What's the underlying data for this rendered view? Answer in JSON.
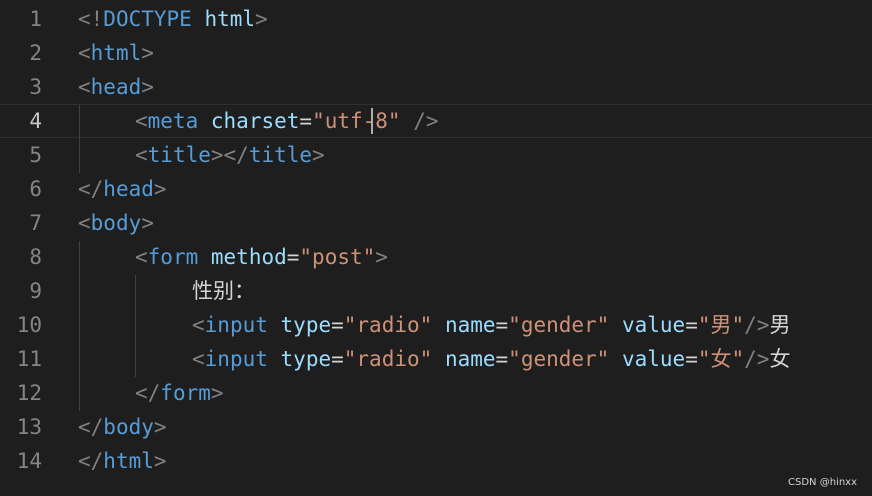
{
  "editor": {
    "language": "html",
    "active_line": 4,
    "cursor": {
      "line": 4,
      "column": 21
    },
    "colors": {
      "background": "#1e1e1e",
      "line_number": "#858585",
      "line_number_active": "#c6c6c6",
      "punctuation": "#808080",
      "tag": "#569cd6",
      "attribute": "#9cdcfe",
      "string": "#ce9178",
      "text": "#d4d4d4"
    },
    "lines": [
      {
        "number": "1",
        "indent": 0,
        "tokens": [
          [
            "p",
            "<!"
          ],
          [
            "k",
            "DOCTYPE"
          ],
          [
            "o",
            " "
          ],
          [
            "a",
            "html"
          ],
          [
            "p",
            ">"
          ]
        ]
      },
      {
        "number": "2",
        "indent": 0,
        "tokens": [
          [
            "p",
            "<"
          ],
          [
            "k",
            "html"
          ],
          [
            "p",
            ">"
          ]
        ]
      },
      {
        "number": "3",
        "indent": 0,
        "tokens": [
          [
            "p",
            "<"
          ],
          [
            "k",
            "head"
          ],
          [
            "p",
            ">"
          ]
        ]
      },
      {
        "number": "4",
        "indent": 1,
        "tokens": [
          [
            "p",
            "<"
          ],
          [
            "k",
            "meta"
          ],
          [
            "o",
            " "
          ],
          [
            "a",
            "charset"
          ],
          [
            "o",
            "="
          ],
          [
            "s",
            "\"utf-8\""
          ],
          [
            "o",
            " "
          ],
          [
            "p",
            "/>"
          ]
        ]
      },
      {
        "number": "5",
        "indent": 1,
        "tokens": [
          [
            "p",
            "<"
          ],
          [
            "k",
            "title"
          ],
          [
            "p",
            "></"
          ],
          [
            "k",
            "title"
          ],
          [
            "p",
            ">"
          ]
        ]
      },
      {
        "number": "6",
        "indent": 0,
        "tokens": [
          [
            "p",
            "</"
          ],
          [
            "k",
            "head"
          ],
          [
            "p",
            ">"
          ]
        ]
      },
      {
        "number": "7",
        "indent": 0,
        "tokens": [
          [
            "p",
            "<"
          ],
          [
            "k",
            "body"
          ],
          [
            "p",
            ">"
          ]
        ]
      },
      {
        "number": "8",
        "indent": 1,
        "tokens": [
          [
            "p",
            "<"
          ],
          [
            "k",
            "form"
          ],
          [
            "o",
            " "
          ],
          [
            "a",
            "method"
          ],
          [
            "o",
            "="
          ],
          [
            "s",
            "\"post\""
          ],
          [
            "p",
            ">"
          ]
        ]
      },
      {
        "number": "9",
        "indent": 2,
        "tokens": [
          [
            "t",
            "性别："
          ]
        ]
      },
      {
        "number": "10",
        "indent": 2,
        "tokens": [
          [
            "p",
            "<"
          ],
          [
            "k",
            "input"
          ],
          [
            "o",
            " "
          ],
          [
            "a",
            "type"
          ],
          [
            "o",
            "="
          ],
          [
            "s",
            "\"radio\""
          ],
          [
            "o",
            " "
          ],
          [
            "a",
            "name"
          ],
          [
            "o",
            "="
          ],
          [
            "s",
            "\"gender\""
          ],
          [
            "o",
            " "
          ],
          [
            "a",
            "value"
          ],
          [
            "o",
            "="
          ],
          [
            "s",
            "\"男\""
          ],
          [
            "p",
            "/>"
          ],
          [
            "t",
            "男"
          ]
        ]
      },
      {
        "number": "11",
        "indent": 2,
        "tokens": [
          [
            "p",
            "<"
          ],
          [
            "k",
            "input"
          ],
          [
            "o",
            " "
          ],
          [
            "a",
            "type"
          ],
          [
            "o",
            "="
          ],
          [
            "s",
            "\"radio\""
          ],
          [
            "o",
            " "
          ],
          [
            "a",
            "name"
          ],
          [
            "o",
            "="
          ],
          [
            "s",
            "\"gender\""
          ],
          [
            "o",
            " "
          ],
          [
            "a",
            "value"
          ],
          [
            "o",
            "="
          ],
          [
            "s",
            "\"女\""
          ],
          [
            "p",
            "/>"
          ],
          [
            "t",
            "女"
          ]
        ]
      },
      {
        "number": "12",
        "indent": 1,
        "tokens": [
          [
            "p",
            "</"
          ],
          [
            "k",
            "form"
          ],
          [
            "p",
            ">"
          ]
        ]
      },
      {
        "number": "13",
        "indent": 0,
        "tokens": [
          [
            "p",
            "</"
          ],
          [
            "k",
            "body"
          ],
          [
            "p",
            ">"
          ]
        ]
      },
      {
        "number": "14",
        "indent": 0,
        "tokens": [
          [
            "p",
            "</"
          ],
          [
            "k",
            "html"
          ],
          [
            "p",
            ">"
          ]
        ]
      }
    ]
  },
  "watermark": "CSDN @hinxx"
}
